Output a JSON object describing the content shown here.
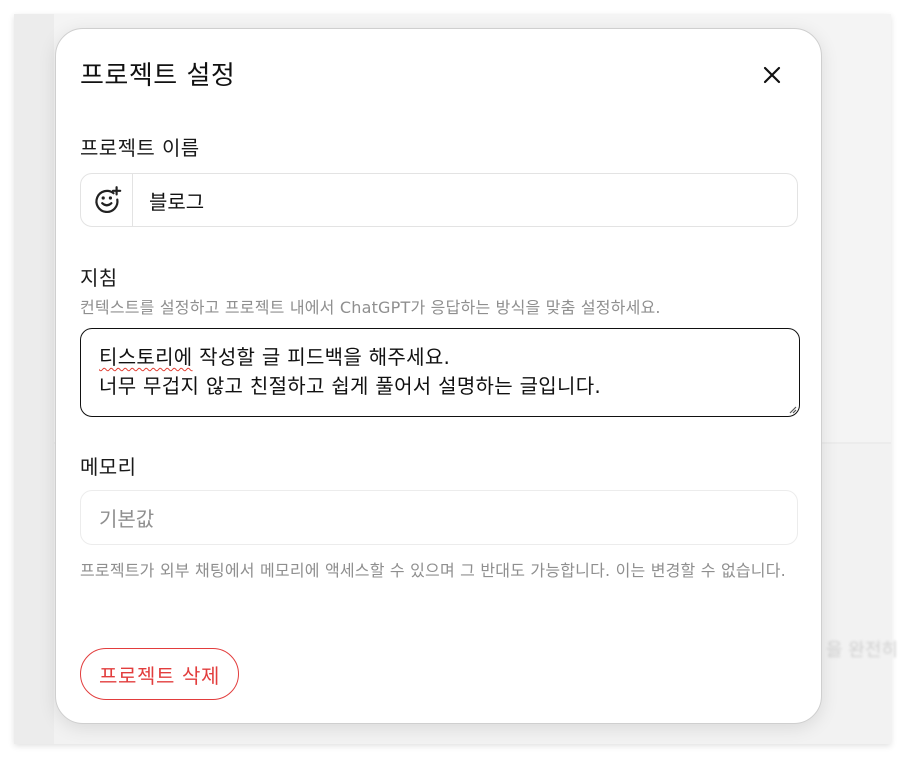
{
  "background": {
    "blurred_text": "을 완전히"
  },
  "dialog": {
    "title": "프로젝트 설정",
    "close_icon": "close-icon"
  },
  "project_name": {
    "label": "프로젝트 이름",
    "value": "블로그",
    "emoji_icon": "add-emoji-icon"
  },
  "instructions": {
    "label": "지침",
    "hint": "컨텍스트를 설정하고 프로젝트 내에서 ChatGPT가 응답하는 방식을 맞춤 설정하세요.",
    "line1_misspelled": "티스토리에",
    "line1_rest": " 작성할 글 피드백을 해주세요.",
    "line2": "너무 무겁지 않고 친절하고 쉽게 풀어서 설명하는 글입니다."
  },
  "memory": {
    "label": "메모리",
    "selected": "기본값",
    "hint": "프로젝트가 외부 채팅에서 메모리에 액세스할 수 있으며 그 반대도 가능합니다. 이는 변경할 수 없습니다."
  },
  "actions": {
    "delete_label": "프로젝트 삭제"
  },
  "colors": {
    "danger": "#e23d3d",
    "text": "#111111",
    "muted": "#8f8f8f",
    "border": "#e3e3e3"
  }
}
